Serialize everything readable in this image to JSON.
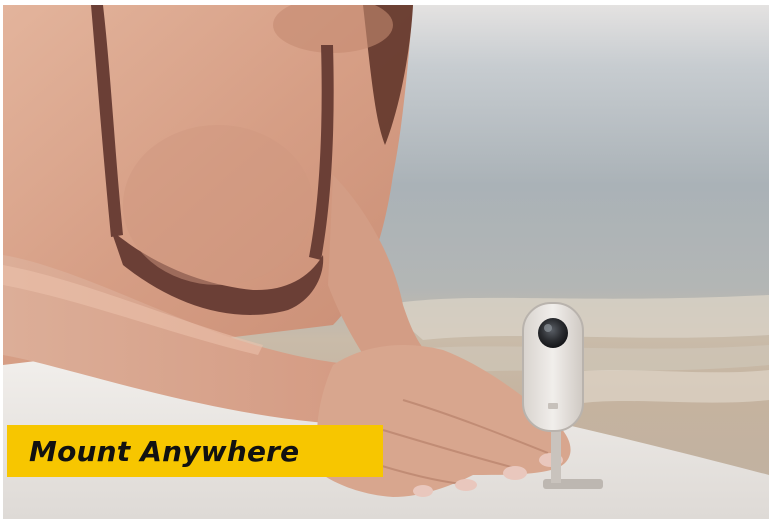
{
  "caption": {
    "text": "Mount Anywhere",
    "background_color": "#f7c600",
    "text_color": "#111111"
  },
  "scene": {
    "colors": {
      "sky": "#e9e6e3",
      "sea": "#a9b3b7",
      "foam": "#d7d2c8",
      "sand": "#c8b8a6",
      "board": "#ebe7e3",
      "skin": "#d9a48c",
      "swimsuit": "#6b3f36",
      "camera_body": "#eae6e2",
      "camera_lens": "#2a2a2c"
    }
  }
}
